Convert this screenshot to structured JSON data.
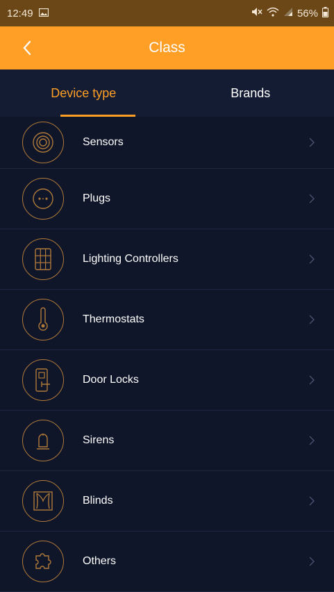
{
  "status_bar": {
    "time": "12:49",
    "battery": "56%"
  },
  "header": {
    "title": "Class"
  },
  "tabs": [
    {
      "label": "Device type",
      "active": true
    },
    {
      "label": "Brands",
      "active": false
    }
  ],
  "items": [
    {
      "label": "Sensors",
      "icon": "sensor-icon"
    },
    {
      "label": "Plugs",
      "icon": "plug-icon"
    },
    {
      "label": "Lighting Controllers",
      "icon": "light-switch-icon"
    },
    {
      "label": "Thermostats",
      "icon": "thermometer-icon"
    },
    {
      "label": "Door Locks",
      "icon": "door-lock-icon"
    },
    {
      "label": "Sirens",
      "icon": "siren-icon"
    },
    {
      "label": "Blinds",
      "icon": "blinds-icon"
    },
    {
      "label": "Others",
      "icon": "puzzle-icon"
    }
  ],
  "colors": {
    "accent": "#ff9f26",
    "background": "#0f1629",
    "icon_stroke": "#b07a3a"
  }
}
